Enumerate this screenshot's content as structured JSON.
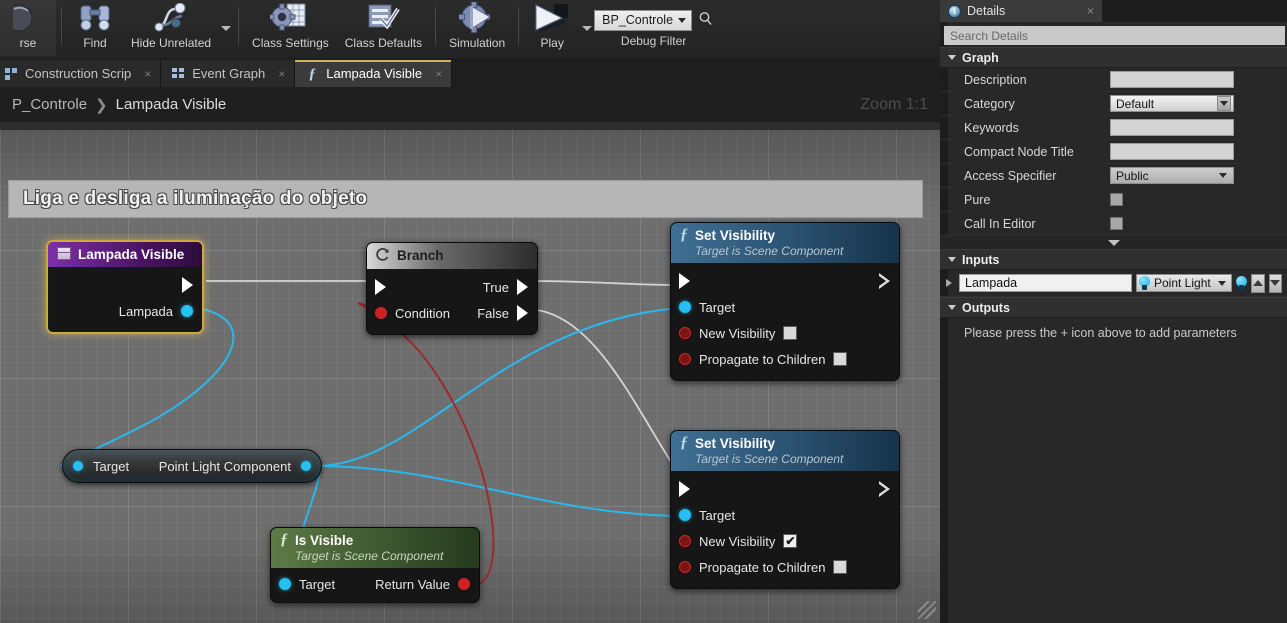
{
  "toolbar": {
    "buttons": [
      {
        "label": "rse",
        "icon": "browse-icon"
      },
      {
        "label": "Find",
        "icon": "binoculars-icon"
      },
      {
        "label": "Hide Unrelated",
        "icon": "hide-unrelated-icon"
      },
      {
        "label": "Class Settings",
        "icon": "gear-document-icon"
      },
      {
        "label": "Class Defaults",
        "icon": "clipboard-check-icon"
      },
      {
        "label": "Simulation",
        "icon": "gear-play-icon"
      },
      {
        "label": "Play",
        "icon": "play-icon"
      }
    ],
    "debug_filter": {
      "value": "BP_Controle",
      "label": "Debug Filter",
      "search_icon": "magnifier-icon"
    }
  },
  "tabs": [
    {
      "label": "Construction Scrip",
      "icon": "construction-script-icon",
      "active": false
    },
    {
      "label": "Event Graph",
      "icon": "event-graph-icon",
      "active": false
    },
    {
      "label": "Lampada Visible",
      "icon": "function-icon",
      "active": true
    }
  ],
  "breadcrumb": {
    "root": "P_Controle",
    "separator": "❯",
    "current": "Lampada Visible",
    "zoom": "Zoom 1:1"
  },
  "graph": {
    "comment": "Liga e desliga a iluminação do objeto",
    "nodes": [
      {
        "id": "lampada-visible",
        "type": "event",
        "title": "Lampada Visible",
        "icon": "event-node-icon",
        "pins_out": [
          {
            "kind": "exec",
            "label": ""
          },
          {
            "kind": "object",
            "label": "Lampada"
          }
        ]
      },
      {
        "id": "branch",
        "type": "flow",
        "title": "Branch",
        "icon": "branch-icon",
        "pins_in": [
          {
            "kind": "exec",
            "label": ""
          },
          {
            "kind": "bool",
            "label": "Condition"
          }
        ],
        "pins_out": [
          {
            "kind": "exec",
            "label": "True"
          },
          {
            "kind": "exec",
            "label": "False"
          }
        ]
      },
      {
        "id": "set-visibility-1",
        "type": "function",
        "title": "Set Visibility",
        "subtitle": "Target is Scene Component",
        "icon": "function-icon",
        "pins_in": [
          {
            "kind": "exec",
            "label": ""
          },
          {
            "kind": "object",
            "label": "Target"
          },
          {
            "kind": "bool",
            "label": "New Visibility",
            "checkbox": false
          },
          {
            "kind": "bool",
            "label": "Propagate to Children",
            "checkbox": false
          }
        ]
      },
      {
        "id": "set-visibility-2",
        "type": "function",
        "title": "Set Visibility",
        "subtitle": "Target is Scene Component",
        "icon": "function-icon",
        "pins_in": [
          {
            "kind": "exec",
            "label": ""
          },
          {
            "kind": "object",
            "label": "Target"
          },
          {
            "kind": "bool",
            "label": "New Visibility",
            "checkbox": true
          },
          {
            "kind": "bool",
            "label": "Propagate to Children",
            "checkbox": false
          }
        ]
      },
      {
        "id": "point-light-component",
        "type": "variable",
        "title": "Point Light Component",
        "pins_in": [
          {
            "kind": "object",
            "label": "Target"
          }
        ]
      },
      {
        "id": "is-visible",
        "type": "pure-function",
        "title": "Is Visible",
        "subtitle": "Target is Scene Component",
        "icon": "function-icon",
        "pins_in": [
          {
            "kind": "object",
            "label": "Target"
          }
        ],
        "pins_out": [
          {
            "kind": "bool",
            "label": "Return Value"
          }
        ]
      }
    ],
    "resize_grip": "resize-grip"
  },
  "details": {
    "tab_title": "Details",
    "tab_icon": "info-icon",
    "close": "×",
    "search_placeholder": "Search Details",
    "sections": [
      {
        "name": "Graph",
        "rows": [
          {
            "label": "Description",
            "control": "text",
            "value": ""
          },
          {
            "label": "Category",
            "control": "combo",
            "value": "Default"
          },
          {
            "label": "Keywords",
            "control": "text",
            "value": ""
          },
          {
            "label": "Compact Node Title",
            "control": "text",
            "value": ""
          },
          {
            "label": "Access Specifier",
            "control": "combo",
            "value": "Public"
          },
          {
            "label": "Pure",
            "control": "checkbox",
            "value": ""
          },
          {
            "label": "Call In Editor",
            "control": "checkbox",
            "value": ""
          }
        ]
      }
    ],
    "inputs": {
      "name": "Inputs",
      "rows": [
        {
          "param_name": "Lampada",
          "param_type": "Point Light",
          "type_icon": "point-light-icon"
        }
      ],
      "move_up": "▲",
      "move_down": "▼"
    },
    "outputs": {
      "name": "Outputs",
      "hint": "Please press the + icon above to add parameters"
    }
  },
  "colors": {
    "exec_wire": "#d5d5d5",
    "object_wire": "#29b8ee",
    "bool_wire": "#9c2b2b",
    "selected_node": "#cfa83c",
    "tab_accent": "#c9b45a"
  }
}
